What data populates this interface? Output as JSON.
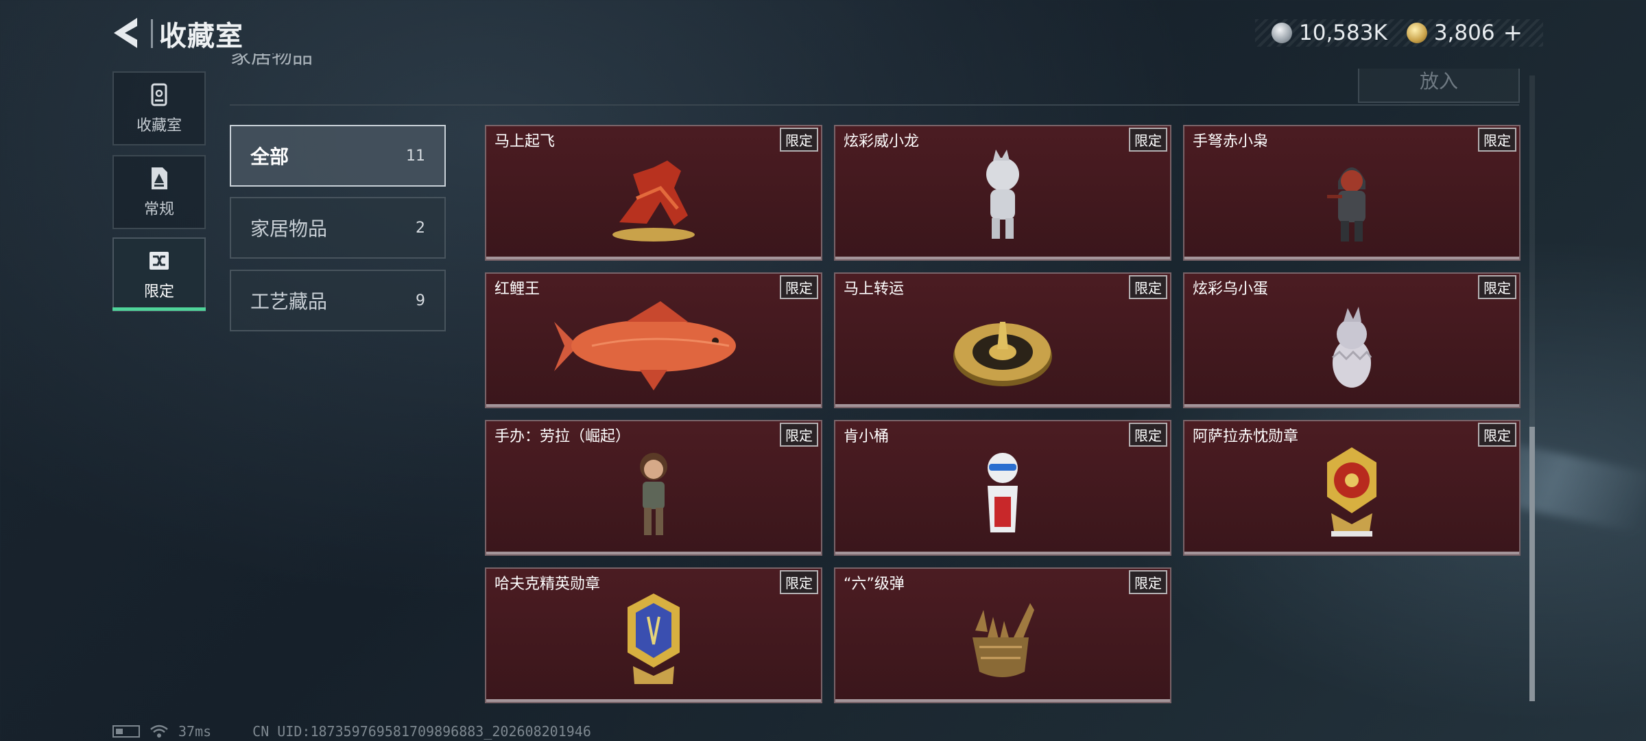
{
  "header": {
    "title": "收藏室",
    "section_title_partial": "家居物品",
    "place_button": "放入"
  },
  "currency": {
    "silver_amount": "10,583K",
    "gold_amount": "3,806",
    "plus": "+"
  },
  "nav": {
    "items": [
      {
        "label": "收藏室",
        "icon": "bin-icon"
      },
      {
        "label": "常规",
        "icon": "document-icon"
      },
      {
        "label": "限定",
        "icon": "shuffle-card-icon",
        "active": true
      }
    ]
  },
  "categories": [
    {
      "name": "全部",
      "count": "11",
      "active": true
    },
    {
      "name": "家居物品",
      "count": "2"
    },
    {
      "name": "工艺藏品",
      "count": "9"
    }
  ],
  "items": [
    {
      "name": "马上起飞",
      "tag": "限定",
      "icon": "red-horse-figure-icon"
    },
    {
      "name": "炫彩威小龙",
      "tag": "限定",
      "icon": "white-dragon-figure-icon"
    },
    {
      "name": "手弩赤小枭",
      "tag": "限定",
      "icon": "hooded-figure-icon"
    },
    {
      "name": "红鲤王",
      "tag": "限定",
      "icon": "red-carp-icon"
    },
    {
      "name": "马上转运",
      "tag": "限定",
      "icon": "gold-wheel-icon"
    },
    {
      "name": "炫彩乌小蛋",
      "tag": "限定",
      "icon": "egg-figure-icon"
    },
    {
      "name": "手办：劳拉（崛起）",
      "tag": "限定",
      "icon": "lara-figure-icon"
    },
    {
      "name": "肯小桶",
      "tag": "限定",
      "icon": "colonel-figure-icon"
    },
    {
      "name": "阿萨拉赤忱勋章",
      "tag": "限定",
      "icon": "gold-medal-icon"
    },
    {
      "name": "哈夫克精英勋章",
      "tag": "限定",
      "icon": "blue-hex-medal-icon"
    },
    {
      "name": "“六”级弹",
      "tag": "限定",
      "icon": "bullet-hand-icon"
    }
  ],
  "status": {
    "latency": "37ms",
    "uid": "CN UID:18735976958170989688​3_202608201946"
  }
}
